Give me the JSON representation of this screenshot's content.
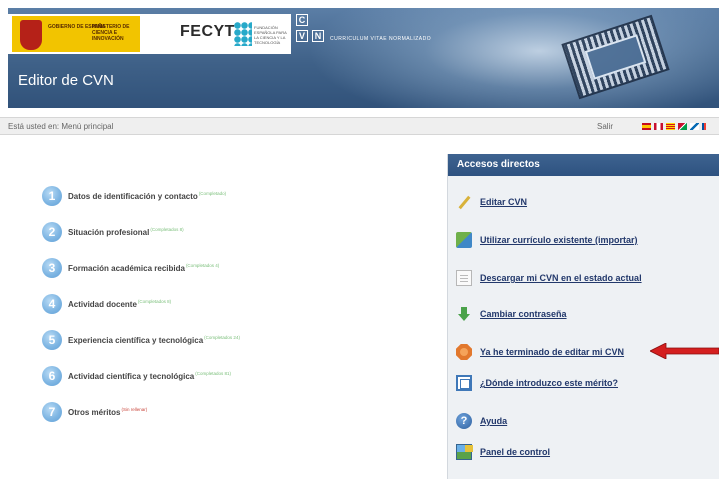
{
  "header": {
    "logo_gobierno": "GOBIERNO DE ESPAÑA",
    "logo_ministerio": "MINISTERIO DE CIENCIA E INNOVACIÓN",
    "logo_fecyt": "FECYT",
    "logo_fecyt_sub": "FUNDACIÓN ESPAÑOLA PARA LA CIENCIA Y LA TECNOLOGÍA",
    "cvn_letters": [
      "C",
      "V",
      "N"
    ],
    "cvn_tagline": "CURRICULUM VITAE NORMALIZADO",
    "app_title": "Editor de CVN"
  },
  "breadcrumb": {
    "text": "Está usted en: Menú principal",
    "exit_label": "Salir",
    "language_flags": [
      "es-flag-icon",
      "en-flag-icon",
      "ca-flag-icon",
      "gl-flag-icon",
      "eu-flag-icon",
      "fr-flag-icon"
    ]
  },
  "sections": [
    {
      "number": "1",
      "label": "Datos de identificación y contacto",
      "status": "(Completado)",
      "status_color": "#7bbf7b"
    },
    {
      "number": "2",
      "label": "Situación profesional",
      "status": "(Completados 8)",
      "status_color": "#7bbf7b"
    },
    {
      "number": "3",
      "label": "Formación académica recibida",
      "status": "(Completados 4)",
      "status_color": "#7bbf7b"
    },
    {
      "number": "4",
      "label": "Actividad docente",
      "status": "(Completados 8)",
      "status_color": "#7bbf7b"
    },
    {
      "number": "5",
      "label": "Experiencia científica y tecnológica",
      "status": "(Completados 24)",
      "status_color": "#7bbf7b"
    },
    {
      "number": "6",
      "label": "Actividad científica y tecnológica",
      "status": "(Completados 81)",
      "status_color": "#7bbf7b"
    },
    {
      "number": "7",
      "label": "Otros méritos",
      "status": "(Sin rellenar)",
      "status_color": "#c9463c"
    }
  ],
  "shortcuts": {
    "title": "Accesos directos",
    "items": [
      {
        "label": "Editar CVN",
        "icon": "pencil-icon"
      },
      {
        "label": "Utilizar currículo existente (importar)",
        "icon": "import-icon"
      },
      {
        "label": "Descargar mi CVN en el estado actual",
        "icon": "document-icon"
      },
      {
        "label": "Cambiar contraseña",
        "icon": "down-arrow-icon"
      },
      {
        "label": "Ya he terminado de editar mi CVN",
        "icon": "stop-icon"
      },
      {
        "label": "¿Dónde introduzco este mérito?",
        "icon": "merit-icon"
      },
      {
        "label": "Ayuda",
        "icon": "help-icon",
        "glyph": "?"
      },
      {
        "label": "Panel de control",
        "icon": "control-panel-icon"
      }
    ]
  },
  "annotation": {
    "arrow_color": "#d41f1f",
    "points_to": "Ya he terminado de editar mi CVN"
  }
}
